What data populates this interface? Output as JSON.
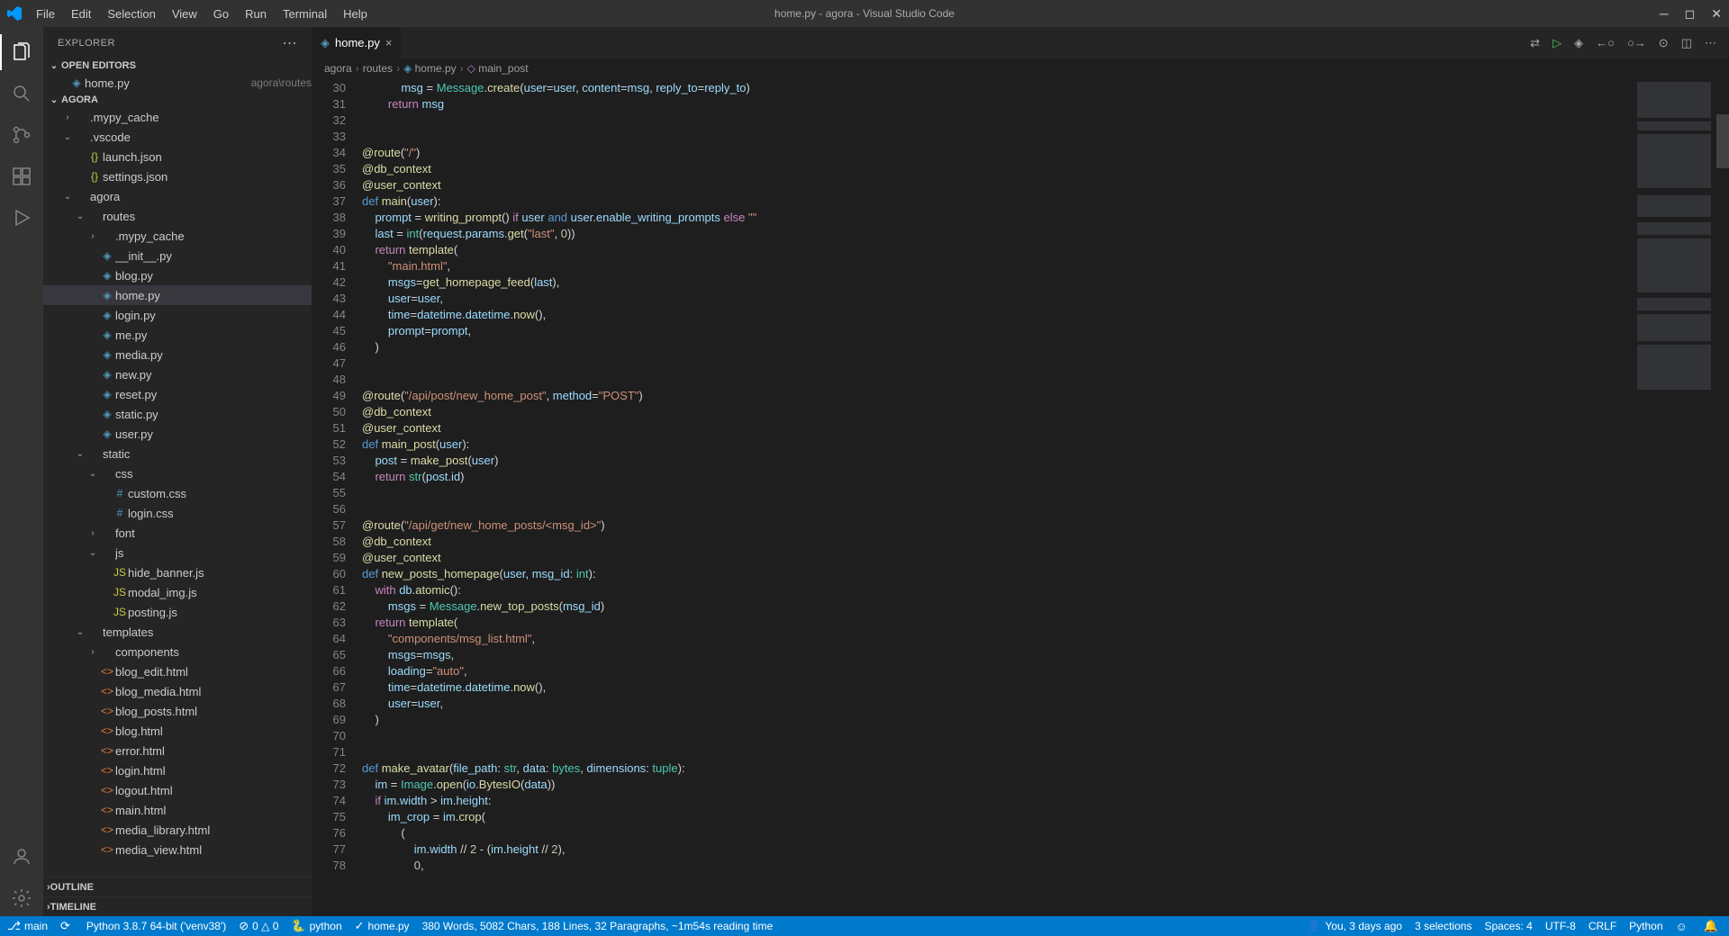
{
  "window": {
    "title": "home.py - agora - Visual Studio Code"
  },
  "menubar": [
    "File",
    "Edit",
    "Selection",
    "View",
    "Go",
    "Run",
    "Terminal",
    "Help"
  ],
  "activitybar": [
    {
      "name": "explorer-icon",
      "active": true
    },
    {
      "name": "search-icon",
      "active": false
    },
    {
      "name": "source-control-icon",
      "active": false
    },
    {
      "name": "extensions-icon",
      "active": false
    },
    {
      "name": "run-debug-icon",
      "active": false
    }
  ],
  "activitybar_bottom": [
    {
      "name": "accounts-icon"
    },
    {
      "name": "settings-gear-icon"
    }
  ],
  "sidebar": {
    "title": "EXPLORER",
    "open_editors": {
      "label": "OPEN EDITORS",
      "items": [
        {
          "icon": "py",
          "name": "home.py",
          "desc": "agora\\routes"
        }
      ]
    },
    "workspace": {
      "label": "AGORA",
      "tree": [
        {
          "depth": 1,
          "kind": "folder",
          "chev": "›",
          "name": ".mypy_cache"
        },
        {
          "depth": 1,
          "kind": "folder",
          "chev": "⌄",
          "name": ".vscode"
        },
        {
          "depth": 2,
          "kind": "json",
          "name": "launch.json"
        },
        {
          "depth": 2,
          "kind": "json",
          "name": "settings.json"
        },
        {
          "depth": 1,
          "kind": "folder",
          "chev": "⌄",
          "name": "agora"
        },
        {
          "depth": 2,
          "kind": "folder",
          "chev": "⌄",
          "name": "routes"
        },
        {
          "depth": 3,
          "kind": "folder",
          "chev": "›",
          "name": ".mypy_cache"
        },
        {
          "depth": 3,
          "kind": "py",
          "name": "__init__.py"
        },
        {
          "depth": 3,
          "kind": "py",
          "name": "blog.py"
        },
        {
          "depth": 3,
          "kind": "py",
          "name": "home.py",
          "active": true
        },
        {
          "depth": 3,
          "kind": "py",
          "name": "login.py"
        },
        {
          "depth": 3,
          "kind": "py",
          "name": "me.py"
        },
        {
          "depth": 3,
          "kind": "py",
          "name": "media.py"
        },
        {
          "depth": 3,
          "kind": "py",
          "name": "new.py"
        },
        {
          "depth": 3,
          "kind": "py",
          "name": "reset.py"
        },
        {
          "depth": 3,
          "kind": "py",
          "name": "static.py"
        },
        {
          "depth": 3,
          "kind": "py",
          "name": "user.py"
        },
        {
          "depth": 2,
          "kind": "folder",
          "chev": "⌄",
          "name": "static"
        },
        {
          "depth": 3,
          "kind": "folder",
          "chev": "⌄",
          "name": "css"
        },
        {
          "depth": 4,
          "kind": "css",
          "name": "custom.css"
        },
        {
          "depth": 4,
          "kind": "css",
          "name": "login.css"
        },
        {
          "depth": 3,
          "kind": "folder",
          "chev": "›",
          "name": "font"
        },
        {
          "depth": 3,
          "kind": "folder",
          "chev": "⌄",
          "name": "js"
        },
        {
          "depth": 4,
          "kind": "js",
          "name": "hide_banner.js"
        },
        {
          "depth": 4,
          "kind": "js",
          "name": "modal_img.js"
        },
        {
          "depth": 4,
          "kind": "js",
          "name": "posting.js"
        },
        {
          "depth": 2,
          "kind": "folder",
          "chev": "⌄",
          "name": "templates"
        },
        {
          "depth": 3,
          "kind": "folder",
          "chev": "›",
          "name": "components"
        },
        {
          "depth": 3,
          "kind": "html",
          "name": "blog_edit.html"
        },
        {
          "depth": 3,
          "kind": "html",
          "name": "blog_media.html"
        },
        {
          "depth": 3,
          "kind": "html",
          "name": "blog_posts.html"
        },
        {
          "depth": 3,
          "kind": "html",
          "name": "blog.html"
        },
        {
          "depth": 3,
          "kind": "html",
          "name": "error.html"
        },
        {
          "depth": 3,
          "kind": "html",
          "name": "login.html"
        },
        {
          "depth": 3,
          "kind": "html",
          "name": "logout.html"
        },
        {
          "depth": 3,
          "kind": "html",
          "name": "main.html"
        },
        {
          "depth": 3,
          "kind": "html",
          "name": "media_library.html"
        },
        {
          "depth": 3,
          "kind": "html",
          "name": "media_view.html"
        }
      ]
    },
    "outline": "OUTLINE",
    "timeline": "TIMELINE"
  },
  "tabs": [
    {
      "icon": "py",
      "name": "home.py"
    }
  ],
  "breadcrumbs": [
    "agora",
    "routes",
    "home.py",
    "main_post"
  ],
  "code": {
    "first_line": 30,
    "lines": [
      "            <span class='var'>msg</span> = <span class='cls'>Message</span>.<span class='fn'>create</span>(<span class='param'>user</span>=<span class='var'>user</span>, <span class='param'>content</span>=<span class='var'>msg</span>, <span class='param'>reply_to</span>=<span class='var'>reply_to</span>)",
      "        <span class='kw'>return</span> <span class='var'>msg</span>",
      "",
      "",
      "<span class='dec'>@route</span>(<span class='str'>\"/\"</span>)",
      "<span class='dec'>@db_context</span>",
      "<span class='dec'>@user_context</span>",
      "<span class='kw2'>def</span> <span class='fn'>main</span>(<span class='param'>user</span>):",
      "    <span class='var'>prompt</span> = <span class='fn'>writing_prompt</span>() <span class='kw'>if</span> <span class='var'>user</span> <span class='kw2'>and</span> <span class='var'>user</span>.<span class='var'>enable_writing_prompts</span> <span class='kw'>else</span> <span class='str'>\"\"</span>",
      "    <span class='var'>last</span> = <span class='cls'>int</span>(<span class='var'>request</span>.<span class='var'>params</span>.<span class='fn'>get</span>(<span class='str'>\"last\"</span>, <span class='num'>0</span>))",
      "    <span class='kw'>return</span> <span class='fn'>template</span>(",
      "        <span class='str'>\"main.html\"</span>,",
      "        <span class='param'>msgs</span>=<span class='fn'>get_homepage_feed</span>(<span class='var'>last</span>),",
      "        <span class='param'>user</span>=<span class='var'>user</span>,",
      "        <span class='param'>time</span>=<span class='var'>datetime</span>.<span class='var'>datetime</span>.<span class='fn'>now</span>(),",
      "        <span class='param'>prompt</span>=<span class='var'>prompt</span>,",
      "    )",
      "",
      "",
      "<span class='dec'>@route</span>(<span class='str'>\"/api/post/new_home_post\"</span>, <span class='param'>method</span>=<span class='str'>\"POST\"</span>)",
      "<span class='dec'>@db_context</span>",
      "<span class='dec'>@user_context</span>",
      "<span class='kw2'>def</span> <span class='fn'>main_post</span>(<span class='param'>user</span>):",
      "    <span class='var'>post</span> = <span class='fn'>make_post</span>(<span class='var'>user</span>)",
      "    <span class='kw'>return</span> <span class='cls'>str</span>(<span class='var'>post</span>.<span class='var'>id</span>)",
      "",
      "",
      "<span class='dec'>@route</span>(<span class='str'>\"/api/get/new_home_posts/&lt;msg_id&gt;\"</span>)",
      "<span class='dec'>@db_context</span>",
      "<span class='dec'>@user_context</span>",
      "<span class='kw2'>def</span> <span class='fn'>new_posts_homepage</span>(<span class='param'>user</span>, <span class='param'>msg_id</span>: <span class='cls'>int</span>):",
      "    <span class='kw'>with</span> <span class='var'>db</span>.<span class='fn'>atomic</span>():",
      "        <span class='var'>msgs</span> = <span class='cls'>Message</span>.<span class='fn'>new_top_posts</span>(<span class='var'>msg_id</span>)",
      "    <span class='kw'>return</span> <span class='fn'>template</span>(",
      "        <span class='str'>\"components/msg_list.html\"</span>,",
      "        <span class='param'>msgs</span>=<span class='var'>msgs</span>,",
      "        <span class='param'>loading</span>=<span class='str'>\"auto\"</span>,",
      "        <span class='param'>time</span>=<span class='var'>datetime</span>.<span class='var'>datetime</span>.<span class='fn'>now</span>(),",
      "        <span class='param'>user</span>=<span class='var'>user</span>,",
      "    )",
      "",
      "",
      "<span class='kw2'>def</span> <span class='fn'>make_avatar</span>(<span class='param'>file_path</span>: <span class='cls'>str</span>, <span class='param'>data</span>: <span class='cls'>bytes</span>, <span class='param'>dimensions</span>: <span class='cls'>tuple</span>):",
      "    <span class='var'>im</span> = <span class='cls'>Image</span>.<span class='fn'>open</span>(<span class='var'>io</span>.<span class='fn'>BytesIO</span>(<span class='var'>data</span>))",
      "    <span class='kw'>if</span> <span class='var'>im</span>.<span class='var'>width</span> &gt; <span class='var'>im</span>.<span class='var'>height</span>:",
      "        <span class='var'>im_crop</span> = <span class='var'>im</span>.<span class='fn'>crop</span>(",
      "            (",
      "                <span class='var'>im</span>.<span class='var'>width</span> // <span class='num'>2</span> - (<span class='var'>im</span>.<span class='var'>height</span> // <span class='num'>2</span>),",
      "                <span class='num'>0</span>,"
    ]
  },
  "statusbar": {
    "left": [
      {
        "name": "branch",
        "icon": "⎇",
        "text": "main"
      },
      {
        "name": "sync",
        "icon": "⟳",
        "text": ""
      },
      {
        "name": "python-env",
        "icon": "",
        "text": "Python 3.8.7 64-bit ('venv38')"
      },
      {
        "name": "problems",
        "icon": "⊘",
        "text": "0 △ 0"
      },
      {
        "name": "interpreter",
        "icon": "🐍",
        "text": "python"
      },
      {
        "name": "current-file",
        "icon": "✓",
        "text": "home.py"
      },
      {
        "name": "stats",
        "icon": "",
        "text": "380 Words, 5082 Chars, 188 Lines, 32 Paragraphs, ~1m54s reading time"
      }
    ],
    "right": [
      {
        "name": "blame",
        "icon": "👤",
        "text": "You, 3 days ago"
      },
      {
        "name": "selections",
        "text": "3 selections"
      },
      {
        "name": "spaces",
        "text": "Spaces: 4"
      },
      {
        "name": "encoding",
        "text": "UTF-8"
      },
      {
        "name": "eol",
        "text": "CRLF"
      },
      {
        "name": "language",
        "text": "Python"
      },
      {
        "name": "feedback",
        "icon": "☺",
        "text": ""
      },
      {
        "name": "notifications",
        "icon": "🔔",
        "text": ""
      }
    ]
  },
  "icons": {
    "py": "◈",
    "json": "{}",
    "folder": "",
    "css": "#",
    "js": "JS",
    "html": "<>"
  }
}
